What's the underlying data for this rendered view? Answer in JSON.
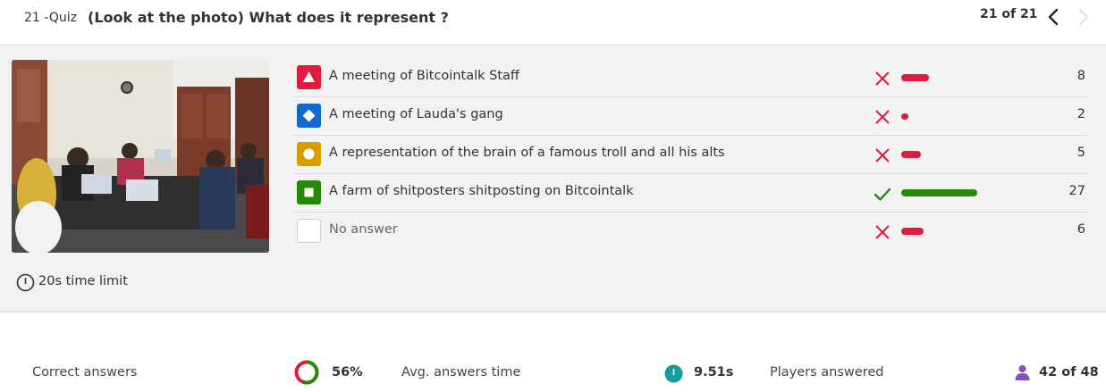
{
  "header": {
    "quiz_number": "21 -Quiz",
    "question": "(Look at the photo) What does it represent ?",
    "counter": "21 of 21"
  },
  "answers": [
    {
      "shape": "triangle-icon",
      "color": "#e21b3c",
      "text": "A meeting of Bitcointalk Staff",
      "correct": false,
      "count": "8",
      "fraction": 0.296
    },
    {
      "shape": "diamond-icon",
      "color": "#1368ce",
      "text": "A meeting of Lauda's gang",
      "correct": false,
      "count": "2",
      "fraction": 0.0
    },
    {
      "shape": "circle-icon",
      "color": "#d89e00",
      "text": "A representation of the brain of a famous troll and all his alts",
      "correct": false,
      "count": "5",
      "fraction": 0.185
    },
    {
      "shape": "square-icon",
      "color": "#26890c",
      "text": "A farm of shitposters shitposting on Bitcointalk",
      "correct": true,
      "count": "27",
      "fraction": 1.0
    },
    {
      "shape": "empty-box-icon",
      "color": "#ffffff",
      "text": "No answer",
      "correct": false,
      "count": "6",
      "fraction": 0.222
    }
  ],
  "time_limit": "20s time limit",
  "footer": {
    "correct_label": "Correct answers",
    "correct_value": "56%",
    "correct_fraction": 0.56,
    "avg_label": "Avg. answers time",
    "avg_value": "9.51s",
    "players_label": "Players answered",
    "players_value": "42 of 48"
  },
  "colors": {
    "wrong": "#e21b3c",
    "right": "#26890c",
    "teal": "#1a9a9a",
    "purple": "#864cbf"
  }
}
